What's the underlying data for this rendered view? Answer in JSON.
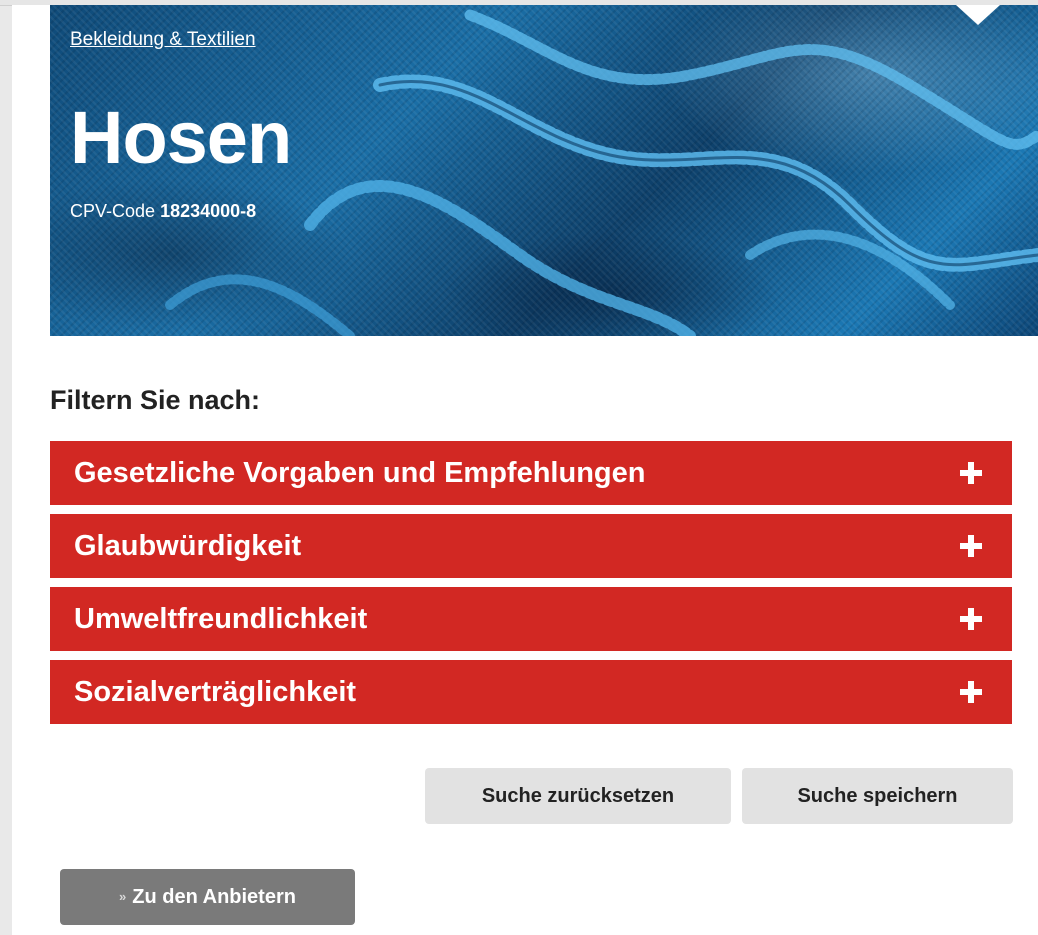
{
  "hero": {
    "breadcrumb": "Bekleidung & Textilien",
    "title": "Hosen",
    "cpv_label": "CPV-Code",
    "cpv_code": "18234000-8"
  },
  "filter": {
    "heading": "Filtern Sie nach:",
    "items": [
      {
        "label": "Gesetzliche Vorgaben und Empfehlungen",
        "icon": "plus-icon"
      },
      {
        "label": "Glaubwürdigkeit",
        "icon": "plus-icon"
      },
      {
        "label": "Umweltfreundlichkeit",
        "icon": "plus-icon"
      },
      {
        "label": "Sozialverträglichkeit",
        "icon": "plus-icon"
      }
    ]
  },
  "actions": {
    "reset_label": "Suche zurücksetzen",
    "save_label": "Suche speichern"
  },
  "providers_button": {
    "icon": "double-chevron-down-icon",
    "glyph": "»",
    "label": "Zu den Anbietern"
  },
  "colors": {
    "accent_red": "#d22823",
    "button_gray": "#e2e2e2",
    "button_dark_gray": "#7a7a7a"
  }
}
